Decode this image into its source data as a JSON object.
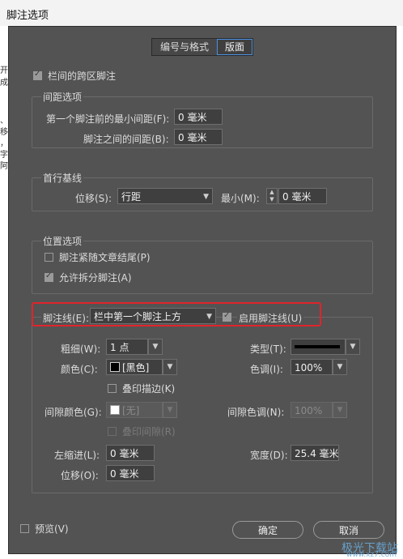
{
  "window": {
    "title": "脚注选项"
  },
  "background_text": [
    "开",
    "成",
    "、",
    "移",
    "，",
    "字",
    "阿"
  ],
  "tabs": [
    {
      "label": "编号与格式"
    },
    {
      "label": "版面"
    }
  ],
  "span_columns": {
    "label": "栏间的跨区脚注",
    "checked": true
  },
  "spacing": {
    "title": "间距选项",
    "min_before_label": "第一个脚注前的最小间距(F):",
    "min_before_value": "0 毫米",
    "between_label": "脚注之间的间距(B):",
    "between_value": "0 毫米"
  },
  "baseline": {
    "title": "首行基线",
    "offset_label": "位移(S):",
    "offset_value": "行距",
    "min_label": "最小(M):",
    "min_value": "0 毫米"
  },
  "placement": {
    "title": "位置选项",
    "end_of_story_label": "脚注紧随文章结尾(P)",
    "end_of_story_checked": false,
    "allow_split_label": "允许拆分脚注(A)",
    "allow_split_checked": true
  },
  "rule": {
    "rule_label": "脚注线(E):",
    "rule_value": "栏中第一个脚注上方",
    "enable_label": "启用脚注线(U)",
    "enable_checked": true,
    "weight_label": "粗细(W):",
    "weight_value": "1 点",
    "type_label": "类型(T):",
    "color_label": "颜色(C):",
    "color_value": "[黑色]",
    "color_swatch": "#000000",
    "tint_label": "色调(I):",
    "tint_value": "100%",
    "overprint_stroke_label": "叠印描边(K)",
    "overprint_stroke_checked": false,
    "gap_color_label": "间隙颜色(G):",
    "gap_color_value": "[无]",
    "gap_tint_label": "间隙色调(N):",
    "gap_tint_value": "100%",
    "overprint_gap_label": "叠印间隙(R)",
    "overprint_gap_checked": false,
    "left_indent_label": "左缩进(L):",
    "left_indent_value": "0 毫米",
    "width_label": "宽度(D):",
    "width_value": "25.4 毫米",
    "offset_label": "位移(O):",
    "offset_value": "0 毫米"
  },
  "preview": {
    "label": "预览(V)",
    "checked": false
  },
  "buttons": {
    "ok": "确定",
    "cancel": "取消"
  },
  "watermark": {
    "text": "极光下载站",
    "url": "www.xz7.com"
  },
  "colors": {
    "highlight": "#e0242c",
    "accent": "#4a90e2"
  }
}
